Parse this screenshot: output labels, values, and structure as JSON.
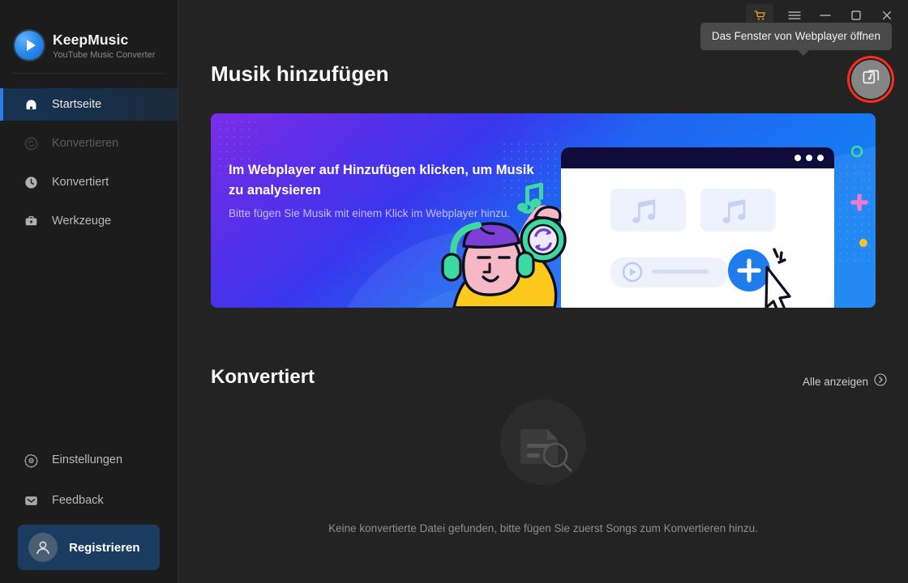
{
  "app": {
    "brand_name": "KeepMusic",
    "brand_tagline": "YouTube Music Converter",
    "logo_icon": "play-circle-logo-icon"
  },
  "titlebar": {
    "cart_icon": "shopping-cart-icon",
    "menu_icon": "hamburger-menu-icon",
    "minimize_icon": "minimize-icon",
    "maximize_icon": "maximize-icon",
    "close_icon": "close-icon"
  },
  "tooltip": {
    "text": "Das Fenster von Webplayer öffnen"
  },
  "sidebar": {
    "items": [
      {
        "label": "Startseite",
        "icon": "home-icon",
        "active": true,
        "disabled": false
      },
      {
        "label": "Konvertieren",
        "icon": "convert-icon",
        "active": false,
        "disabled": true
      },
      {
        "label": "Konvertiert",
        "icon": "clock-icon",
        "active": false,
        "disabled": false
      },
      {
        "label": "Werkzeuge",
        "icon": "toolbox-icon",
        "active": false,
        "disabled": false
      }
    ],
    "bottom_items": [
      {
        "label": "Einstellungen",
        "icon": "gear-icon"
      },
      {
        "label": "Feedback",
        "icon": "message-icon"
      }
    ],
    "register": {
      "label": "Registrieren",
      "icon": "user-avatar-icon"
    }
  },
  "main": {
    "page_title": "Musik hinzufügen",
    "webplayer_button": {
      "icon": "open-webplayer-window-icon"
    },
    "banner": {
      "title": "Im Webplayer auf Hinzufügen klicken, um Musik zu analysieren",
      "subtitle": "Bitte fügen Sie Musik mit einem Klick im Webplayer hinzu."
    },
    "converted": {
      "section_title": "Konvertiert",
      "see_all_label": "Alle anzeigen",
      "see_all_icon": "chevron-right-circle-icon",
      "empty_illustration_icon": "document-search-empty-icon",
      "empty_message": "Keine konvertierte Datei gefunden, bitte fügen Sie zuerst Songs zum Konvertieren hinzu."
    }
  },
  "colors": {
    "sidebar_bg": "#1c1c1c",
    "main_bg": "#232323",
    "accent_blue": "#2f7ae5",
    "active_nav_bg": "#173352",
    "register_bg": "#1b3c61",
    "highlight_ring": "#ff2a1a",
    "tooltip_bg": "#4a4a4a",
    "banner_purple": "#5a2fe8",
    "banner_blue": "#1580f3"
  }
}
